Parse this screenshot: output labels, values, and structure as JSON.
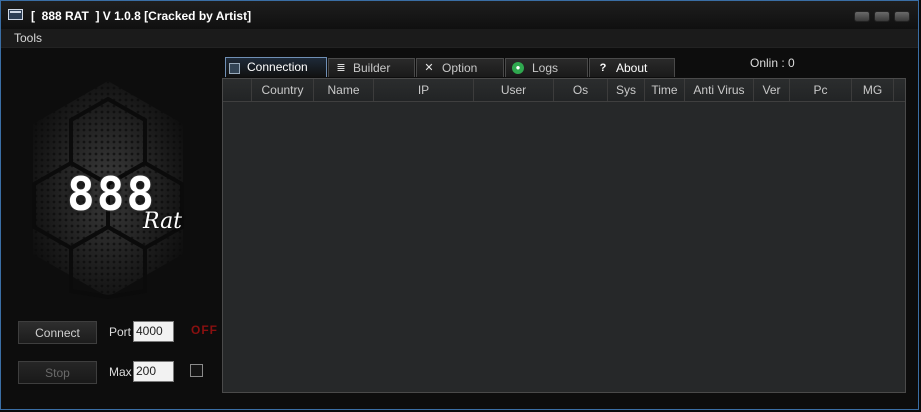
{
  "window": {
    "title": "[  888 RAT  ] V 1.0.8 [Cracked by Artist]"
  },
  "menu": {
    "tools": "Tools"
  },
  "logo": {
    "number": "888",
    "word": "Rat"
  },
  "controls": {
    "connect_label": "Connect",
    "stop_label": "Stop",
    "port_label": "Port",
    "port_value": "4000",
    "max_label": "Max",
    "max_value": "200",
    "status": "OFF",
    "status_color": "#8a1010"
  },
  "tabs": [
    {
      "label": "Connection",
      "icon": "connection-icon",
      "active": true
    },
    {
      "label": "Builder",
      "icon": "builder-icon",
      "active": false
    },
    {
      "label": "Option",
      "icon": "tools-icon",
      "active": false
    },
    {
      "label": "Logs",
      "icon": "logs-icon",
      "active": false
    },
    {
      "label": "About",
      "icon": "question-icon",
      "active": false
    }
  ],
  "online": "Onlin : 0",
  "table": {
    "columns": [
      "Country",
      "Name",
      "IP",
      "User",
      "Os",
      "Sys",
      "Time",
      "Anti Virus",
      "Ver",
      "Pc",
      "MG"
    ],
    "rows": []
  },
  "colors": {
    "accent": "#6f8fb5",
    "background": "#0d0d0d",
    "grid_bg": "#262829"
  }
}
